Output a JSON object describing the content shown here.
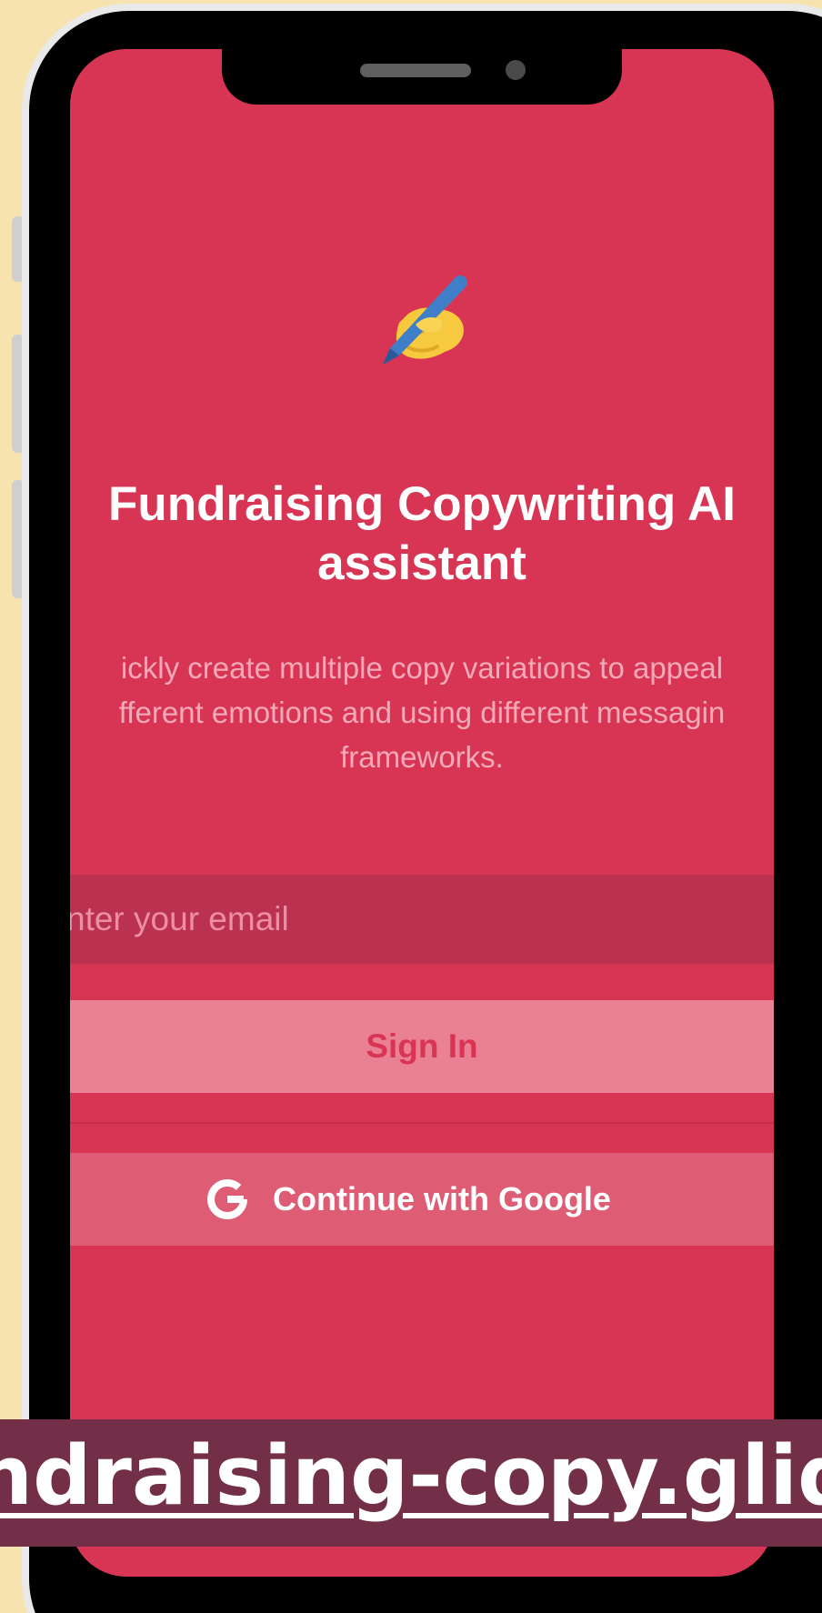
{
  "app": {
    "title": "Fundraising Copywriting AI assistant",
    "description": "Quickly create multiple copy variations to appeal to different emotions and using different messaging frameworks.",
    "description_visible_lines": [
      "ickly create multiple copy variations to appeal",
      "fferent emotions and using different messagin",
      "frameworks."
    ],
    "logo_icon": "writing-hand-icon"
  },
  "login": {
    "email_placeholder": "nter your email",
    "email_value": "",
    "sign_in_label": "Sign In",
    "google_label": "Continue with Google",
    "google_icon": "google-g-icon"
  },
  "banner": {
    "visible_text": "ndraising-copy.glide.pa"
  },
  "colors": {
    "background": "#f7e3b0",
    "screen": "#d83554",
    "email_field": "#bb3250",
    "sign_in_button": "#ea8093",
    "google_button": "#de5c74",
    "banner": "#722f47"
  }
}
